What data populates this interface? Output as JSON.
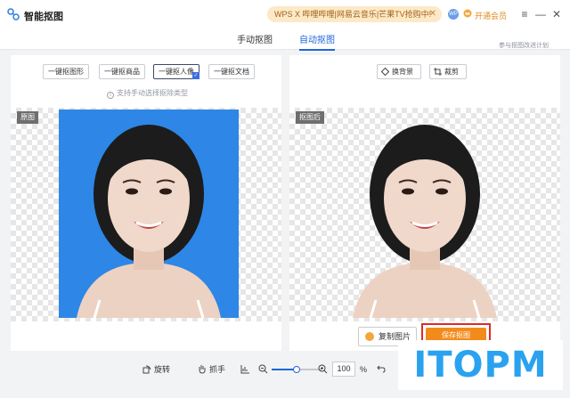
{
  "app": {
    "title": "智能抠图"
  },
  "promo": {
    "text": "WPS X 哔哩哔哩|网易云音乐|芒果TV抢购中!",
    "close": "✕"
  },
  "account": {
    "avatar": "WP",
    "vip_label": "开通会员"
  },
  "window": {
    "menu": "≡",
    "minimize": "—",
    "close": "✕"
  },
  "tabs": [
    {
      "label": "手动抠图"
    },
    {
      "label": "自动抠图"
    }
  ],
  "feedback": "参与抠图改进计划",
  "left_panel": {
    "chips": [
      {
        "label": "一键抠图形"
      },
      {
        "label": "一键抠商品"
      },
      {
        "label": "一键抠人像"
      },
      {
        "label": "一键抠文档"
      }
    ],
    "selected_chip": "一键抠人像",
    "hint": "支持手动选择抠除类型",
    "tag": "原图"
  },
  "right_panel": {
    "replace_bg": "换背景",
    "crop": "裁剪",
    "tag": "抠图后",
    "copy": "复制图片",
    "save": "保存抠图"
  },
  "bottom": {
    "rotate": "旋转",
    "grab": "抓手",
    "zoom_value": "100",
    "zoom_unit": "%"
  },
  "overlay_watermark": "ITOPM",
  "colors": {
    "accent": "#1f66d9",
    "photo_bg": "#2e86e6",
    "save": "#f38b1c",
    "highlight": "#e02a2a"
  }
}
